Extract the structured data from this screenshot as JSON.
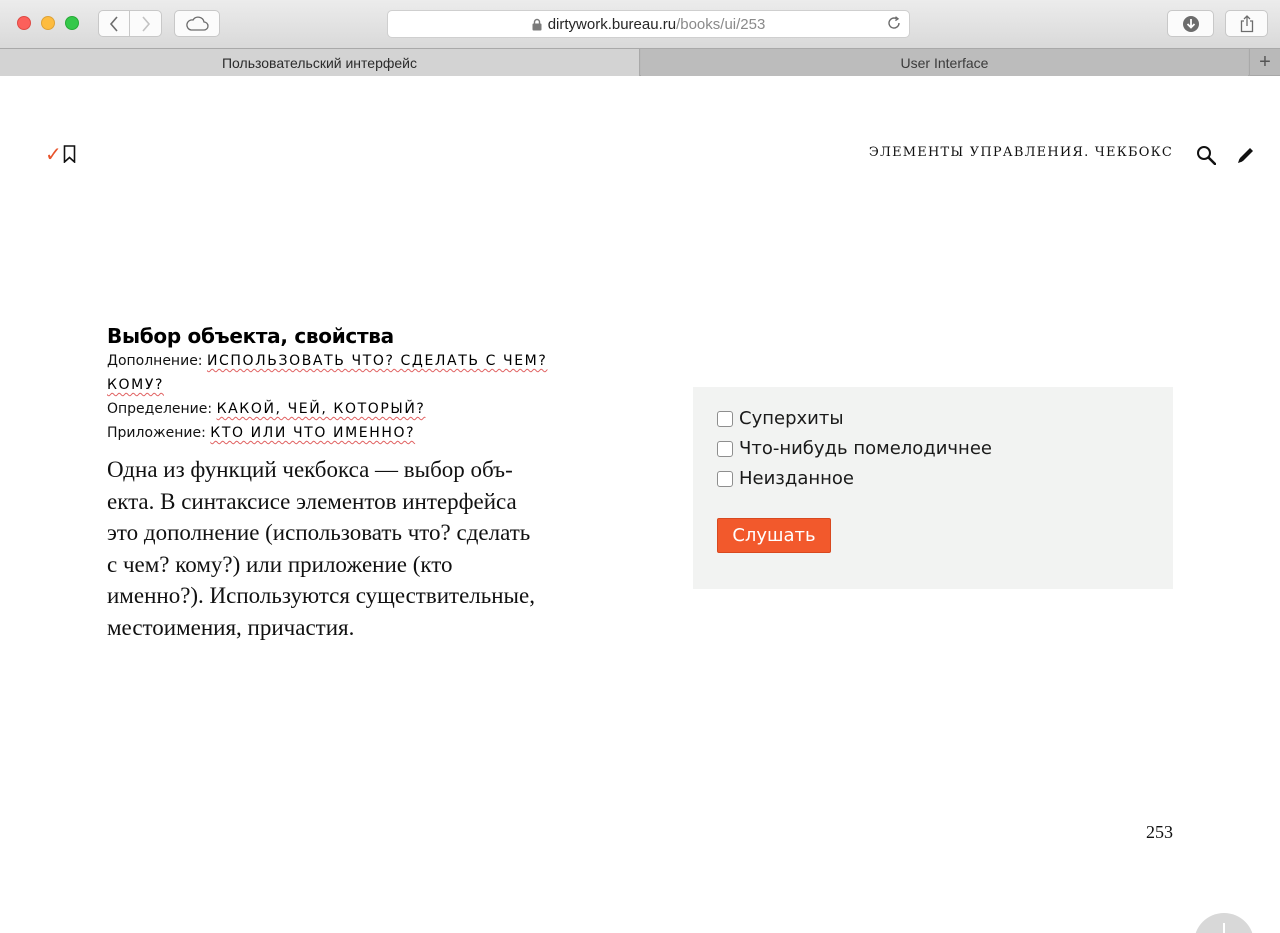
{
  "browser": {
    "url_host": "dirtywork.bureau.ru",
    "url_path": "/books/ui/253",
    "tabs": [
      {
        "label": "Пользовательский интерфейс",
        "active": true
      },
      {
        "label": "User Interface",
        "active": false
      }
    ],
    "new_tab_label": "+"
  },
  "header": {
    "section_title": "ЭЛЕМЕНТЫ УПРАВЛЕНИЯ. ЧЕКБОКС",
    "icons": [
      "checkmark-icon",
      "bookmark-icon",
      "search-icon",
      "pencil-icon"
    ]
  },
  "content": {
    "heading": "Выбор объекта, свойства",
    "definitions": [
      {
        "label": "Дополнение:",
        "value": "ИСПОЛЬЗОВАТЬ ЧТО? СДЕЛАТЬ С ЧЕМ? КОМУ?"
      },
      {
        "label": "Определение:",
        "value": "КАКОЙ, ЧЕЙ, КОТОРЫЙ?"
      },
      {
        "label": "Приложение:",
        "value": "КТО ИЛИ ЧТО ИМЕННО?"
      }
    ],
    "paragraph_lines": [
      "Одна из функций чекбокса — выбор объ-",
      "екта. В синтаксисе элементов интерфейса",
      "это дополнение (использовать что? сделать",
      "с чем? кому?) или приложение (кто",
      "именно?). Используются существительные,",
      "местоимения, причастия."
    ]
  },
  "demo": {
    "checkboxes": [
      {
        "label": "Суперхиты",
        "checked": false
      },
      {
        "label": "Что-нибудь помелодичнее",
        "checked": false
      },
      {
        "label": "Неизданное",
        "checked": false
      }
    ],
    "button_label": "Слушать",
    "accent_color": "#f2592c"
  },
  "footer": {
    "page_number": "253"
  }
}
